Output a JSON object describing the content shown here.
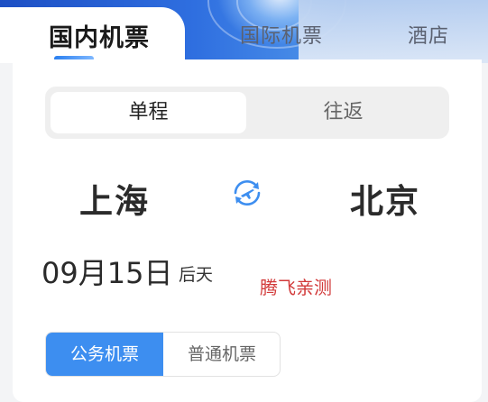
{
  "tabs": [
    {
      "label": "国内机票"
    },
    {
      "label": "国际机票"
    },
    {
      "label": "酒店"
    }
  ],
  "trip_type": {
    "one_way": "单程",
    "round_trip": "往返"
  },
  "route": {
    "from": "上海",
    "to": "北京",
    "swap_icon": "plane-swap-icon"
  },
  "date": {
    "value": "09月15日",
    "relative": "后天"
  },
  "watermark": "腾飞亲测",
  "ticket_type": {
    "business": "公务机票",
    "regular": "普通机票"
  },
  "colors": {
    "accent": "#3d8ef0",
    "watermark": "#d23a3a"
  }
}
